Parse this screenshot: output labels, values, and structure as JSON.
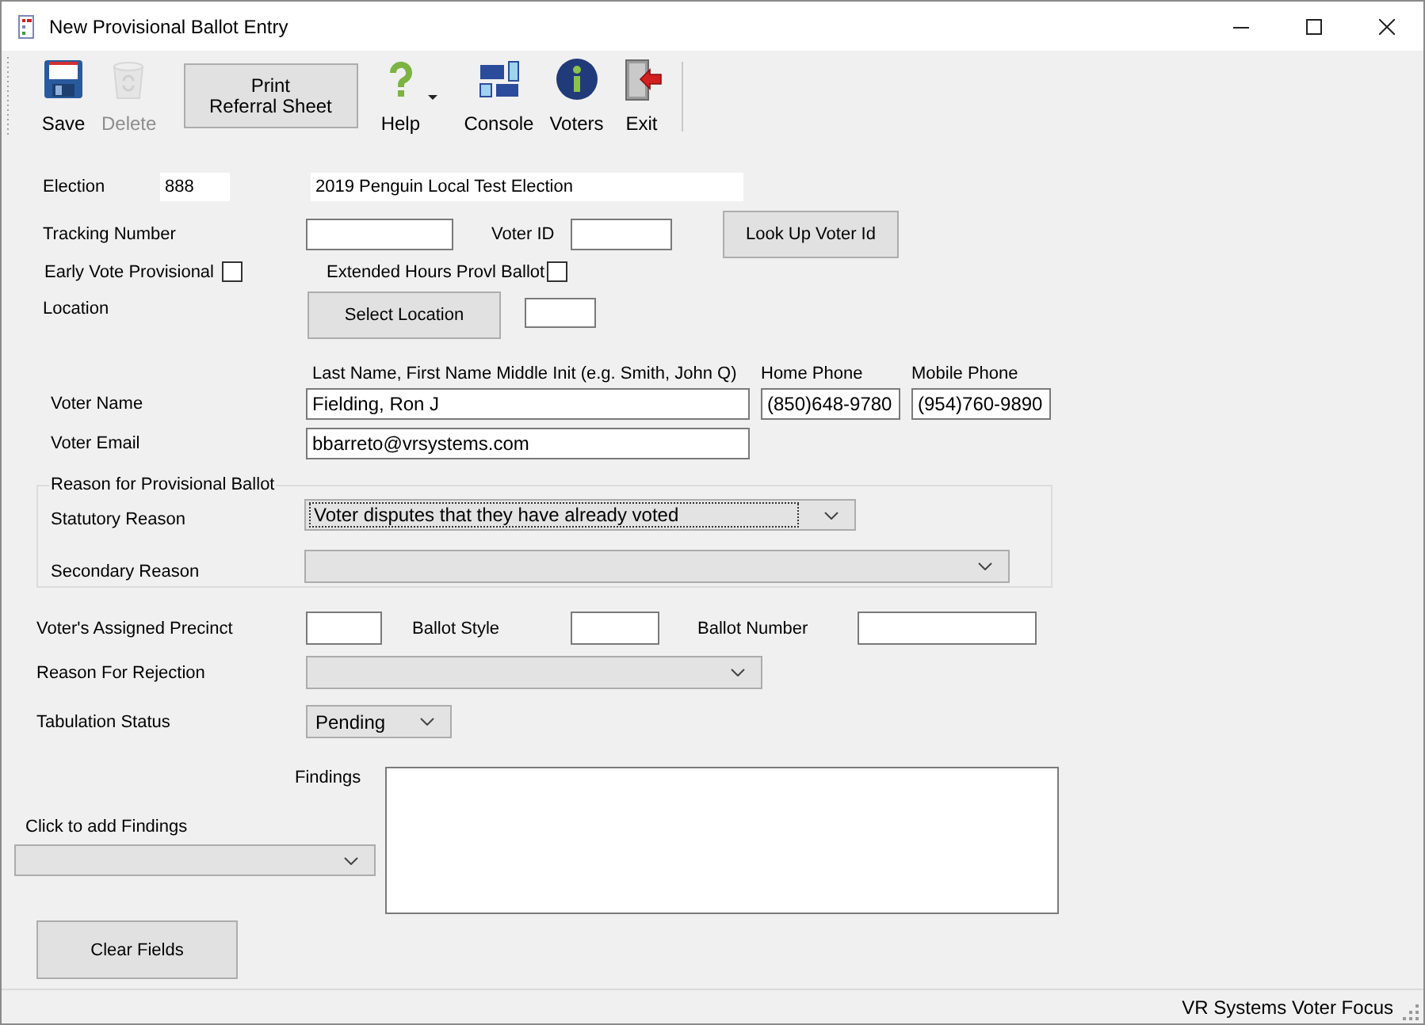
{
  "window": {
    "title": "New Provisional Ballot Entry"
  },
  "toolbar": [
    {
      "kind": "save",
      "label": "Save",
      "disabled": false
    },
    {
      "kind": "delete",
      "label": "Delete",
      "disabled": true
    },
    {
      "kind": "text",
      "label": "Print\nReferral Sheet",
      "disabled": false
    },
    {
      "kind": "help",
      "label": "Help",
      "disabled": false,
      "has_menu": true
    },
    {
      "kind": "console",
      "label": "Console",
      "disabled": false
    },
    {
      "kind": "voters",
      "label": "Voters",
      "disabled": false
    },
    {
      "kind": "exit",
      "label": "Exit",
      "disabled": false
    }
  ],
  "form": {
    "election": {
      "label": "Election",
      "number": "888",
      "name": "2019 Penguin Local Test Election"
    },
    "tracking_number": {
      "label": "Tracking Number"
    },
    "voter_id": {
      "label": "Voter ID"
    },
    "look_up_button": "Look Up Voter Id",
    "early_vote": {
      "label": "Early Vote Provisional",
      "checked": false
    },
    "extended_hours": {
      "label": "Extended Hours Provl Ballot",
      "checked": false
    },
    "location": {
      "label": "Location",
      "button": "Select Location"
    },
    "name_hint": "Last Name, First Name Middle Init (e.g. Smith, John Q)",
    "home_phone": {
      "label": "Home Phone",
      "value": "(850)648-9780"
    },
    "mobile_phone": {
      "label": "Mobile Phone",
      "value": "(954)760-9890"
    },
    "voter_name": {
      "label": "Voter Name",
      "value": "Fielding, Ron J"
    },
    "voter_email": {
      "label": "Voter Email",
      "value": "bbarreto@vrsystems.com"
    },
    "reason_group": {
      "title": "Reason for Provisional Ballot",
      "statutory": {
        "label": "Statutory Reason",
        "value": "Voter disputes that they have already voted"
      },
      "secondary": {
        "label": "Secondary Reason"
      }
    },
    "precinct": {
      "label": "Voter's Assigned Precinct"
    },
    "ballot_style": {
      "label": "Ballot Style"
    },
    "ballot_number": {
      "label": "Ballot Number"
    },
    "rejection": {
      "label": "Reason For Rejection"
    },
    "tabulation": {
      "label": "Tabulation Status",
      "value": "Pending"
    },
    "findings": {
      "label": "Findings"
    },
    "add_findings": {
      "label": "Click to add Findings"
    },
    "clear_button": "Clear Fields"
  },
  "status_bar": {
    "text": "VR Systems Voter Focus"
  }
}
